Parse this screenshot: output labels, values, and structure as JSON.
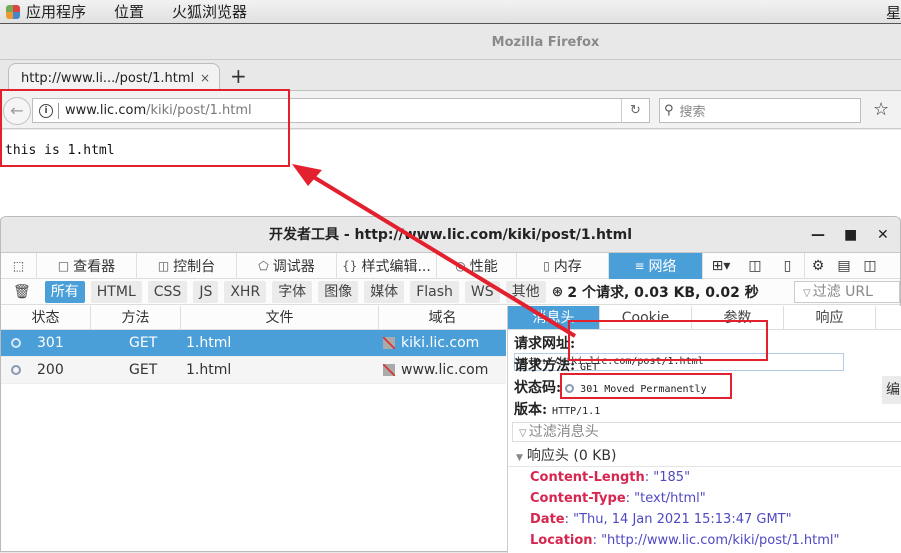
{
  "desktop": {
    "menu": [
      "应用程序",
      "位置",
      "火狐浏览器"
    ],
    "clock_fragment": "星"
  },
  "browser": {
    "window_title": "Mozilla Firefox",
    "tab_title": "http://www.li.../post/1.html",
    "tab_close": "×",
    "new_tab": "+",
    "url_host": "www.lic.com",
    "url_path": "/kiki/post/1.html",
    "search_placeholder": "搜索",
    "page_text": "this is 1.html"
  },
  "devtools": {
    "title": "开发者工具 - http://www.lic.com/kiki/post/1.html",
    "tools": [
      {
        "label": "查看器",
        "icon": "inspector-icon"
      },
      {
        "label": "控制台",
        "icon": "console-icon"
      },
      {
        "label": "调试器",
        "icon": "debugger-icon"
      },
      {
        "label": "样式编辑...",
        "icon": "style-editor-icon"
      },
      {
        "label": "性能",
        "icon": "performance-icon"
      },
      {
        "label": "内存",
        "icon": "memory-icon"
      },
      {
        "label": "网络",
        "icon": "network-icon"
      }
    ],
    "filters": [
      "所有",
      "HTML",
      "CSS",
      "JS",
      "XHR",
      "字体",
      "图像",
      "媒体",
      "Flash",
      "WS",
      "其他"
    ],
    "summary": "2 个请求, 0.03 KB, 0.02 秒",
    "filter_url_placeholder": "过滤 URL",
    "columns": [
      "状态",
      "方法",
      "文件",
      "域名"
    ],
    "requests": [
      {
        "status": "301",
        "method": "GET",
        "file": "1.html",
        "domain": "kiki.lic.com",
        "selected": true
      },
      {
        "status": "200",
        "method": "GET",
        "file": "1.html",
        "domain": "www.lic.com",
        "selected": false
      }
    ],
    "detail_tabs": [
      "消息头",
      "Cookie",
      "参数",
      "响应"
    ],
    "request_url_label": "请求网址:",
    "request_url": "http://kiki.lic.com/post/1.html",
    "request_method_label": "请求方法:",
    "request_method": "GET",
    "status_code_label": "状态码:",
    "status_code": "301 Moved Permanently",
    "version_label": "版本:",
    "version": "HTTP/1.1",
    "edit_button": "编",
    "header_filter_placeholder": "过滤消息头",
    "response_headers_label": "响应头 (0 KB)",
    "response_headers": [
      {
        "name": "Content-Length",
        "value": "\"185\""
      },
      {
        "name": "Content-Type",
        "value": "\"text/html\""
      },
      {
        "name": "Date",
        "value": "\"Thu, 14 Jan 2021 15:13:47 GMT\""
      },
      {
        "name": "Location",
        "value": "\"http://www.lic.com/kiki/post/1.html\""
      }
    ]
  },
  "annotation_color": "#e3202e"
}
